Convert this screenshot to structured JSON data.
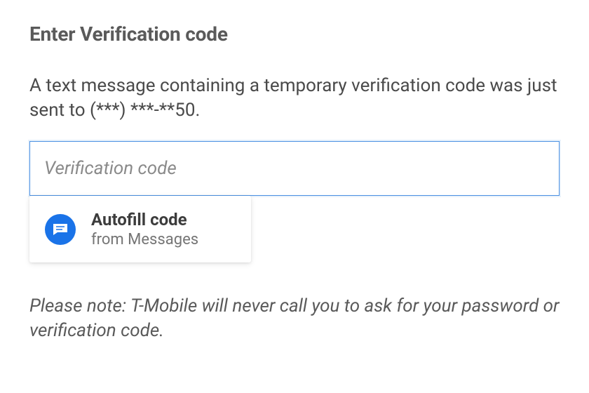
{
  "header": {
    "title": "Enter Verification code"
  },
  "instruction": "A text message containing a temporary verification code was just sent to (***) ***-**50.",
  "input": {
    "placeholder": "Verification code",
    "value": ""
  },
  "autofill": {
    "title": "Autofill code",
    "subtitle": "from Messages",
    "icon": "messages-icon"
  },
  "disclaimer": "Please note: T-Mobile will never call you to ask for your password or verification code."
}
